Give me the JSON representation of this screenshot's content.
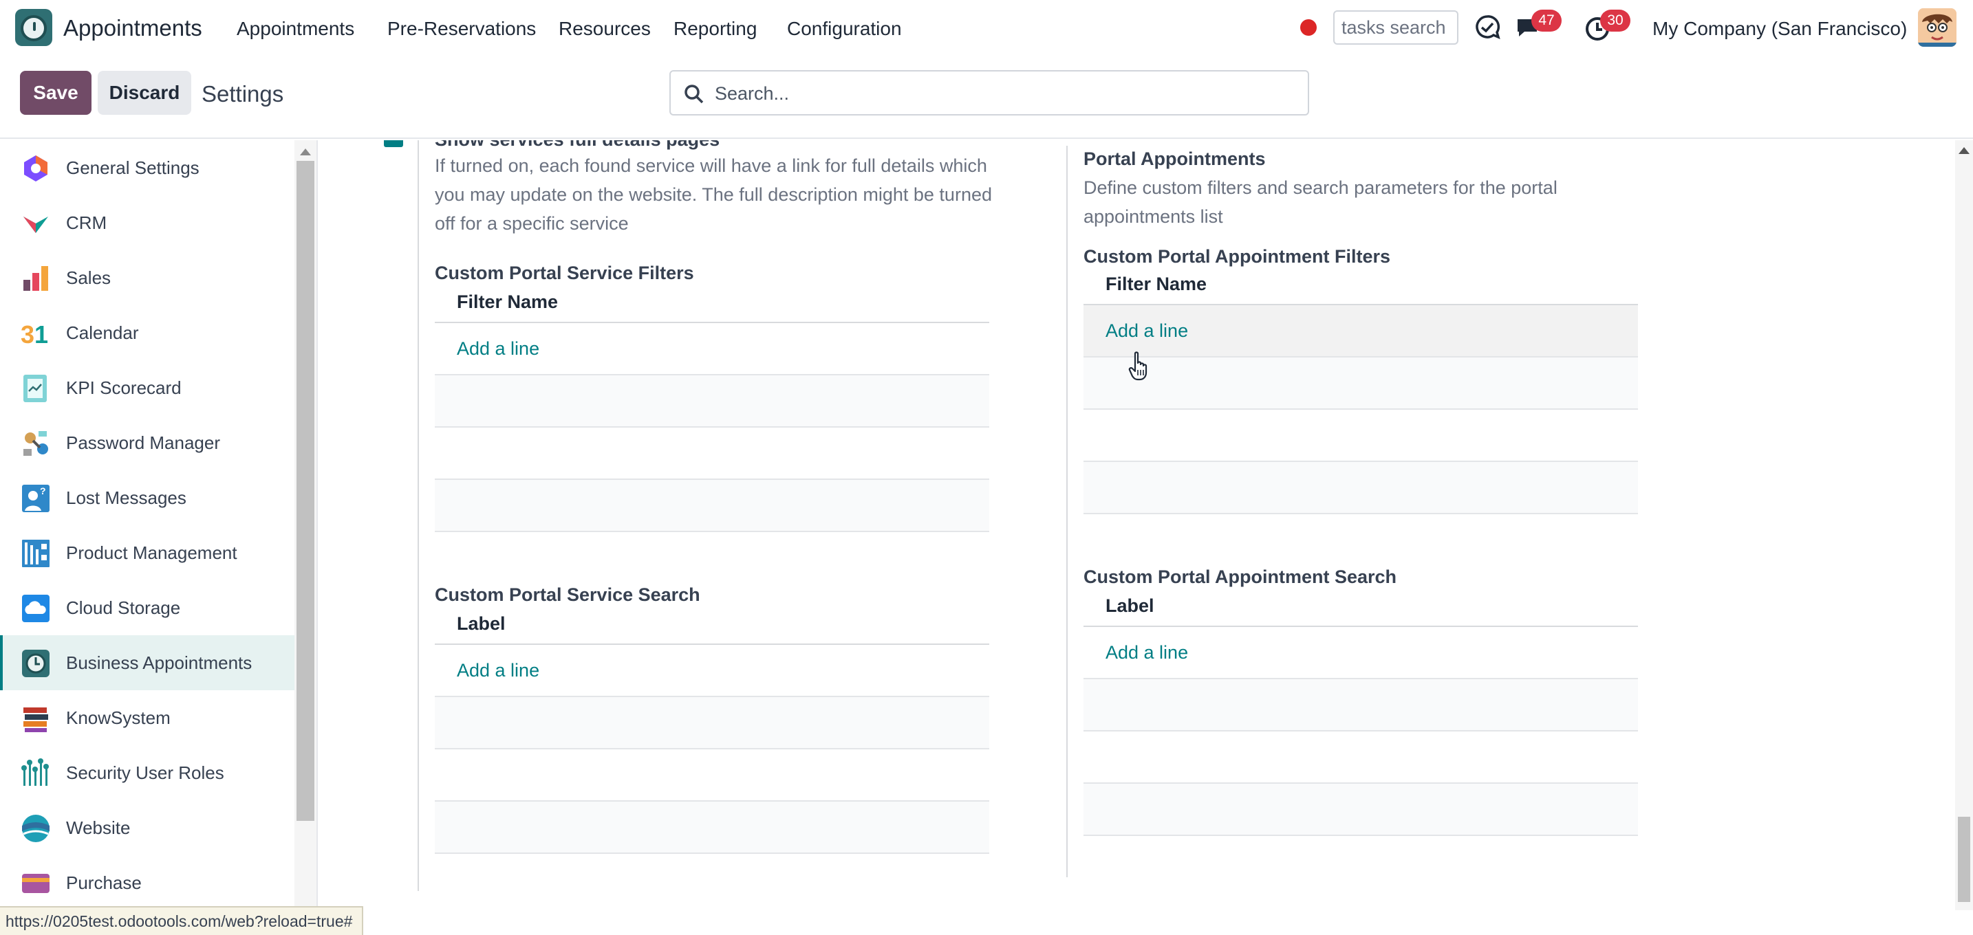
{
  "navbar": {
    "app_name": "Appointments",
    "menu": [
      "Appointments",
      "Pre-Reservations",
      "Resources",
      "Reporting",
      "Configuration"
    ],
    "tasks_search_placeholder": "tasks search",
    "messages_count": "47",
    "activities_count": "30",
    "company": "My Company (San Francisco)"
  },
  "control_panel": {
    "save_label": "Save",
    "discard_label": "Discard",
    "title": "Settings",
    "search_placeholder": "Search..."
  },
  "sidebar": {
    "items": [
      {
        "label": "General Settings",
        "icon": "general-settings-icon",
        "color": "#7c4dff"
      },
      {
        "label": "CRM",
        "icon": "crm-icon",
        "color": "#0f9d94"
      },
      {
        "label": "Sales",
        "icon": "sales-icon",
        "color": "#f4a53c"
      },
      {
        "label": "Calendar",
        "icon": "calendar-icon",
        "color": "#f4a53c"
      },
      {
        "label": "KPI Scorecard",
        "icon": "kpi-scorecard-icon",
        "color": "#7fd3d6"
      },
      {
        "label": "Password Manager",
        "icon": "password-manager-icon",
        "color": "#d4a054"
      },
      {
        "label": "Lost Messages",
        "icon": "lost-messages-icon",
        "color": "#2f88c9"
      },
      {
        "label": "Product Management",
        "icon": "product-management-icon",
        "color": "#2f88c9"
      },
      {
        "label": "Cloud Storage",
        "icon": "cloud-storage-icon",
        "color": "#1e88e5"
      },
      {
        "label": "Business Appointments",
        "icon": "business-appointments-icon",
        "color": "#2f6f73",
        "active": true
      },
      {
        "label": "KnowSystem",
        "icon": "knowsystem-icon",
        "color": "#c0392b"
      },
      {
        "label": "Security User Roles",
        "icon": "security-user-roles-icon",
        "color": "#1f8f8f"
      },
      {
        "label": "Website",
        "icon": "website-icon",
        "color": "#1e9fb6"
      },
      {
        "label": "Purchase",
        "icon": "purchase-icon",
        "color": "#a855a0"
      }
    ]
  },
  "left_column": {
    "top_setting_title": "Show services full details pages",
    "top_setting_desc": "If turned on, each found service will have a link for full details which you may update on the website. The full description might be turned off for a specific service",
    "filters_title": "Custom Portal Service Filters",
    "filters_column": "Filter Name",
    "filters_add": "Add a line",
    "search_title": "Custom Portal Service Search",
    "search_column": "Label",
    "search_add": "Add a line"
  },
  "right_column": {
    "setting_title": "Portal Appointments",
    "setting_desc": "Define custom filters and search parameters for the portal appointments list",
    "filters_title": "Custom Portal Appointment Filters",
    "filters_column": "Filter Name",
    "filters_add": "Add a line",
    "search_title": "Custom Portal Appointment Search",
    "search_column": "Label",
    "search_add": "Add a line"
  },
  "status_bar": {
    "url": "https://0205test.odootools.com/web?reload=true#"
  },
  "colors": {
    "brand": "#714b67",
    "accent": "#017e84",
    "badge": "#dc3545"
  }
}
